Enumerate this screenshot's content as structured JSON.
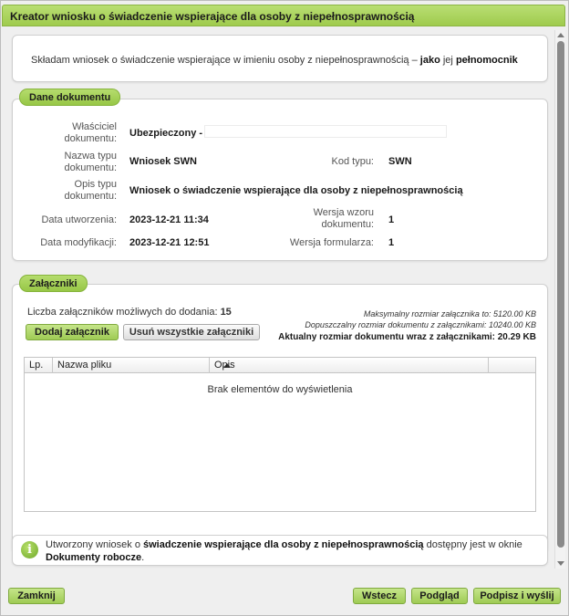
{
  "window": {
    "title": "Kreator wniosku o świadczenie wspierające dla osoby z niepełnosprawnością"
  },
  "intro": {
    "prefix": "Składam wniosek o świadczenie wspierające  w imieniu osoby z niepełnosprawnością –",
    "role1": "jako",
    "middle": "jej",
    "role2": "pełnomocnik"
  },
  "document": {
    "legend": "Dane dokumentu",
    "owner_label_1": "Właściciel",
    "owner_label_2": "dokumentu:",
    "owner_value": "Ubezpieczony -",
    "type_name_label_1": "Nazwa typu",
    "type_name_label_2": "dokumentu:",
    "type_name_value": "Wniosek SWN",
    "type_code_label": "Kod typu:",
    "type_code_value": "SWN",
    "type_desc_label_1": "Opis typu",
    "type_desc_label_2": "dokumentu:",
    "type_desc_value": "Wniosek o świadczenie wspierające dla osoby z niepełnosprawnością",
    "created_label": "Data utworzenia:",
    "created_value": "2023-12-21 11:34",
    "template_ver_label_1": "Wersja wzoru",
    "template_ver_label_2": "dokumentu:",
    "template_ver_value": "1",
    "modified_label": "Data modyfikacji:",
    "modified_value": "2023-12-21 12:51",
    "form_ver_label": "Wersja formularza:",
    "form_ver_value": "1"
  },
  "attachments": {
    "legend": "Załączniki",
    "count_label": "Liczba załączników możliwych do dodania:",
    "count_value": "15",
    "max_attachment": "Maksymalny rozmiar załącznika to: 5120.00 KB",
    "max_document": "Dopuszczalny rozmiar dokumentu z załącznikami: 10240.00 KB",
    "current_size": "Aktualny rozmiar dokumentu wraz z załącznikami: 20.29 KB",
    "add_button": "Dodaj załącznik",
    "remove_all_button": "Usuń wszystkie załączniki",
    "columns": [
      "Lp.",
      "Nazwa pliku",
      "Opis"
    ],
    "empty_text": "Brak elementów do wyświetlenia"
  },
  "info": {
    "prefix": "Utworzony wniosek o",
    "bold1": "świadczenie wspierające dla osoby z niepełnosprawnością",
    "middle": "dostępny jest w oknie",
    "bold2": "Dokumenty robocze",
    "suffix": "."
  },
  "footer": {
    "close_button": "Zamknij",
    "back_button": "Wstecz",
    "preview_button": "Podgląd",
    "sign_send_button": "Podpisz i wyślij"
  },
  "colors": {
    "accent": "#9fcb4d",
    "accent_border": "#86b43c"
  },
  "icons": [
    "info-icon",
    "sort-ascending-icon",
    "scroll-up-icon",
    "scroll-down-icon"
  ]
}
